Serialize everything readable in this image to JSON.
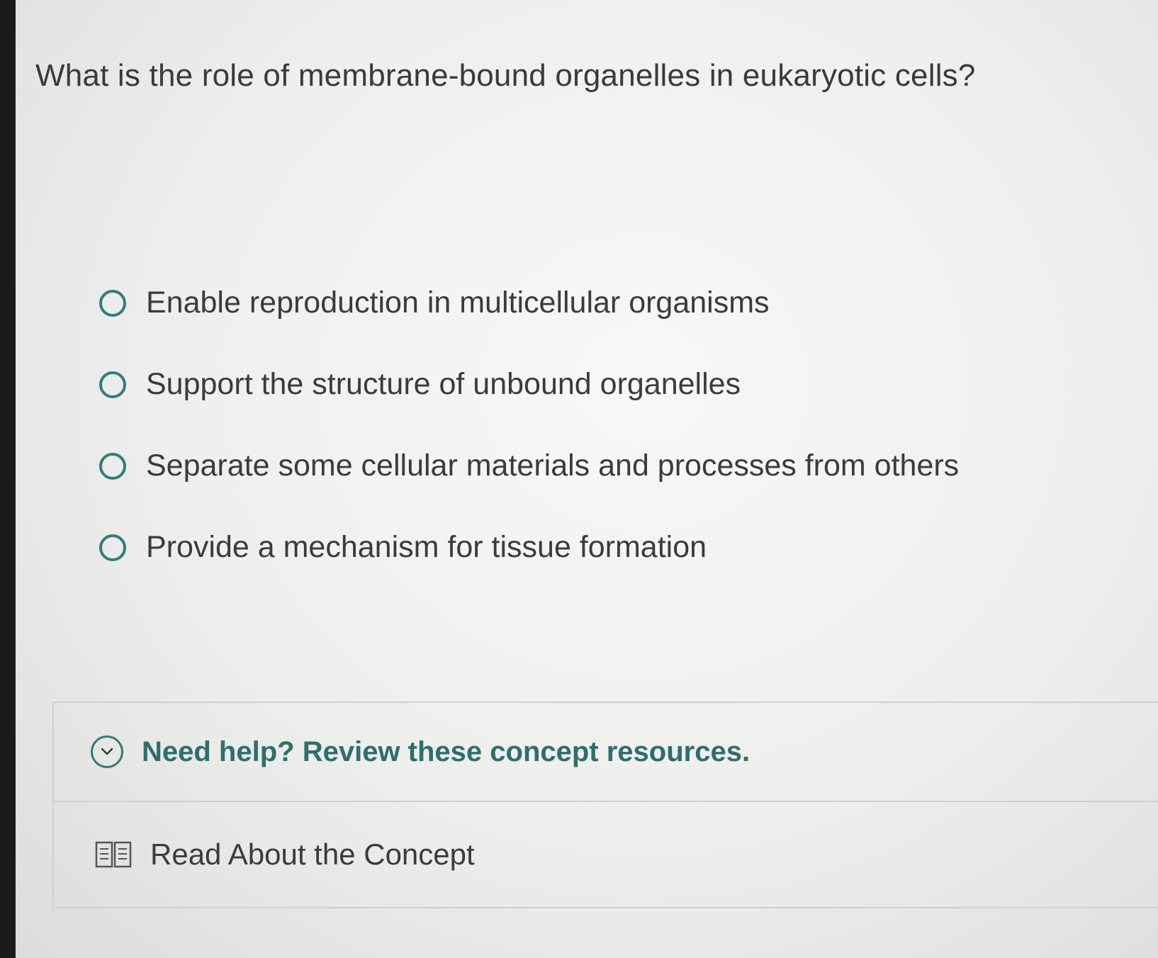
{
  "question": {
    "text": "What is the role of membrane-bound organelles in eukaryotic cells?"
  },
  "options": [
    {
      "label": "Enable reproduction in multicellular organisms",
      "selected": false
    },
    {
      "label": "Support the structure of unbound organelles",
      "selected": false
    },
    {
      "label": "Separate some cellular materials and processes from others",
      "selected": false
    },
    {
      "label": "Provide a mechanism for tissue formation",
      "selected": false
    }
  ],
  "help": {
    "title": "Need help? Review these concept resources.",
    "expand_icon": "chevron-down-icon",
    "resources": [
      {
        "label": "Read About the Concept",
        "icon": "book-icon"
      }
    ]
  },
  "colors": {
    "accent": "#2f7f7b",
    "text": "#3b3b3b",
    "help_title": "#2f6f6b"
  }
}
